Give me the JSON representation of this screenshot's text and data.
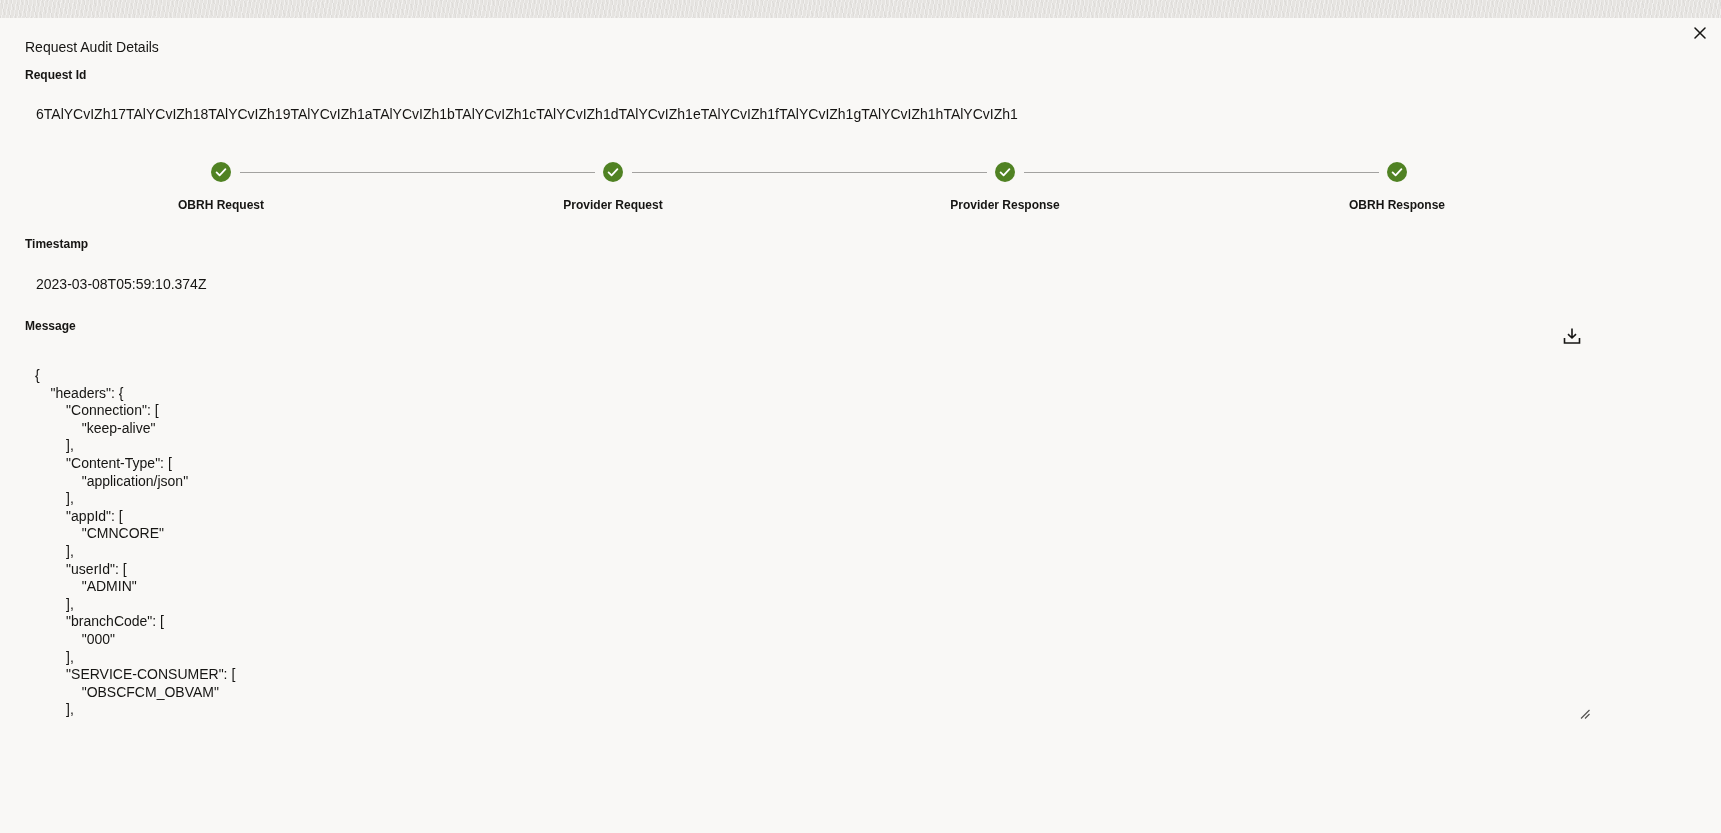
{
  "dialog": {
    "title": "Request Audit Details"
  },
  "request_id": {
    "label": "Request Id",
    "value": "6TAlYCvIZh17TAlYCvIZh18TAlYCvIZh19TAlYCvIZh1aTAlYCvIZh1bTAlYCvIZh1cTAlYCvIZh1dTAlYCvIZh1eTAlYCvIZh1fTAlYCvIZh1gTAlYCvIZh1hTAlYCvIZh1"
  },
  "steps": [
    {
      "label": "OBRH Request",
      "done": true
    },
    {
      "label": "Provider Request",
      "done": true
    },
    {
      "label": "Provider Response",
      "done": true
    },
    {
      "label": "OBRH Response",
      "done": true
    }
  ],
  "timestamp": {
    "label": "Timestamp",
    "value": "2023-03-08T05:59:10.374Z"
  },
  "message": {
    "label": "Message",
    "value": "{\n    \"headers\": {\n        \"Connection\": [\n            \"keep-alive\"\n        ],\n        \"Content-Type\": [\n            \"application/json\"\n        ],\n        \"appId\": [\n            \"CMNCORE\"\n        ],\n        \"userId\": [\n            \"ADMIN\"\n        ],\n        \"branchCode\": [\n            \"000\"\n        ],\n        \"SERVICE-CONSUMER\": [\n            \"OBSCFCM_OBVAM\"\n        ],"
  }
}
